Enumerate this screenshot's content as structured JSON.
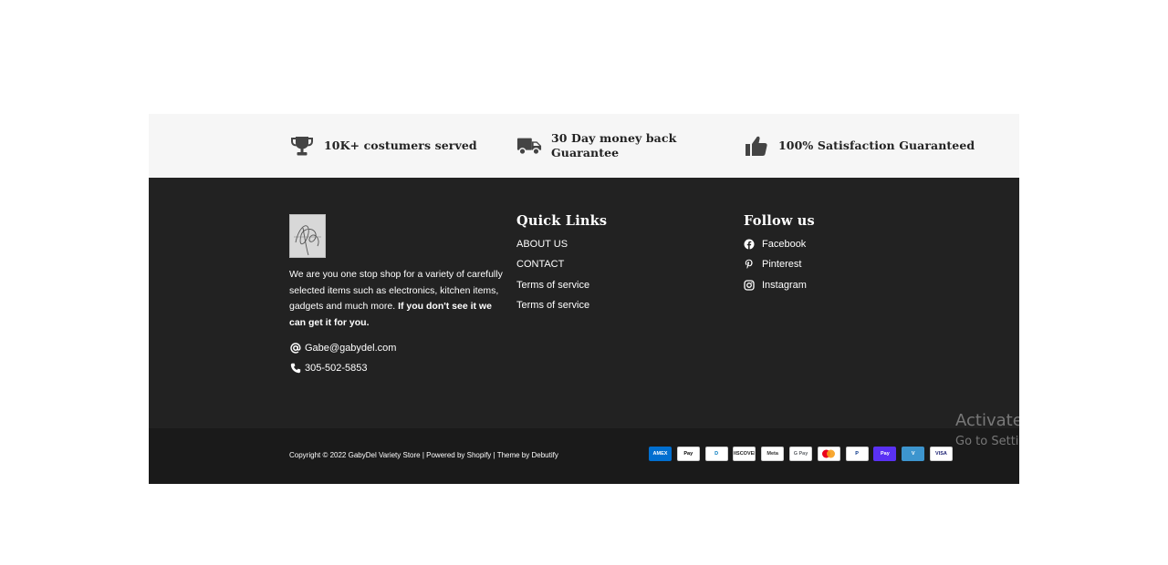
{
  "trust_bar": {
    "items": [
      {
        "icon": "trophy-icon",
        "text": "10K+ costumers served"
      },
      {
        "icon": "truck-icon",
        "line1": "30 Day money back",
        "line2": "Guarantee"
      },
      {
        "icon": "thumbs-up-icon",
        "text": "100% Satisfaction Guaranteed"
      }
    ]
  },
  "about": {
    "logo": "signature-logo",
    "text_normal": "We are you one stop shop for a variety of carefully selected items such as electronics, kitchen items, gadgets and much more. ",
    "text_bold": "If you don't see it we can get it for you.",
    "email": "Gabe@gabydel.com",
    "phone": "305-502-5853"
  },
  "quick_links": {
    "title": "Quick Links",
    "items": [
      "ABOUT US",
      "CONTACT",
      "Terms of service",
      "Terms of service"
    ]
  },
  "follow_us": {
    "title": "Follow us",
    "items": [
      {
        "icon": "facebook-icon",
        "label": "Facebook"
      },
      {
        "icon": "pinterest-icon",
        "label": "Pinterest"
      },
      {
        "icon": "instagram-icon",
        "label": "Instagram"
      }
    ]
  },
  "bottom": {
    "copyright_prefix": "Copyright © 2022 ",
    "store_name": "GabyDel Variety Store",
    "sep1": " | ",
    "powered_by": "Powered by Shopify",
    "sep2": " | ",
    "theme_by": "Theme by Debutify",
    "payments": [
      {
        "label": "AMEX",
        "bg": "#016fd0",
        "fg": "#ffffff"
      },
      {
        "label": "Pay",
        "bg": "#ffffff",
        "fg": "#000000"
      },
      {
        "label": "D",
        "bg": "#ffffff",
        "fg": "#0079be"
      },
      {
        "label": "DISCOVER",
        "bg": "#ffffff",
        "fg": "#222222"
      },
      {
        "label": "Meta",
        "bg": "#ffffff",
        "fg": "#333333"
      },
      {
        "label": "G Pay",
        "bg": "#ffffff",
        "fg": "#5f6368"
      },
      {
        "label": "MC",
        "bg": "#ffffff",
        "fg": "#eb001b"
      },
      {
        "label": "P",
        "bg": "#ffffff",
        "fg": "#003087"
      },
      {
        "label": "Pay",
        "bg": "#5a31f4",
        "fg": "#ffffff"
      },
      {
        "label": "V",
        "bg": "#3d95ce",
        "fg": "#ffffff"
      },
      {
        "label": "VISA",
        "bg": "#ffffff",
        "fg": "#1a1f71"
      }
    ]
  },
  "watermark": {
    "title": "Activate Windows",
    "subtitle": "Go to Settings to activate Windows."
  },
  "colors": {
    "trust_bg": "#f6f6f6",
    "footer_bg": "#222222",
    "bottom_bg": "#1a1a1a",
    "icon_gray": "#444444"
  }
}
